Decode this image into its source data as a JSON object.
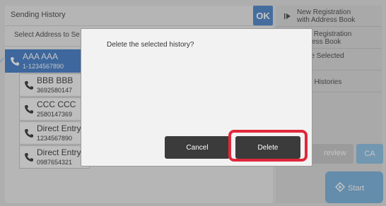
{
  "header": {
    "title": "Sending History",
    "ok_label": "OK"
  },
  "sub_header": {
    "text": "Select Address to Se"
  },
  "history": [
    {
      "name": "AAA AAA",
      "number": "1-1234567890",
      "selected": true
    },
    {
      "name": "BBB BBB",
      "number": "3692580147",
      "selected": false
    },
    {
      "name": "CCC CCC",
      "number": "2580147369",
      "selected": false
    },
    {
      "name": "Direct Entry",
      "number": "1234567890",
      "selected": false
    },
    {
      "name": "Direct Entry",
      "number": "0987654321",
      "selected": false
    }
  ],
  "right_menu": [
    {
      "label_line1": "New Registration",
      "label_line2": "with Address Book"
    },
    {
      "label_line1": "ional Registration",
      "label_line2": "Address Book"
    },
    {
      "label_line1": "te the Selected",
      "label_line2": "ry"
    },
    {
      "label_line1": "te All Histories",
      "label_line2": ""
    }
  ],
  "preview_label": "review",
  "ca_label": "CA",
  "start_label": "Start",
  "dialog": {
    "message": "Delete the selected history?",
    "cancel_label": "Cancel",
    "delete_label": "Delete"
  },
  "colors": {
    "accent": "#2f6fc2",
    "highlight": "#e0283a",
    "dark_button": "#3b3b3b"
  }
}
